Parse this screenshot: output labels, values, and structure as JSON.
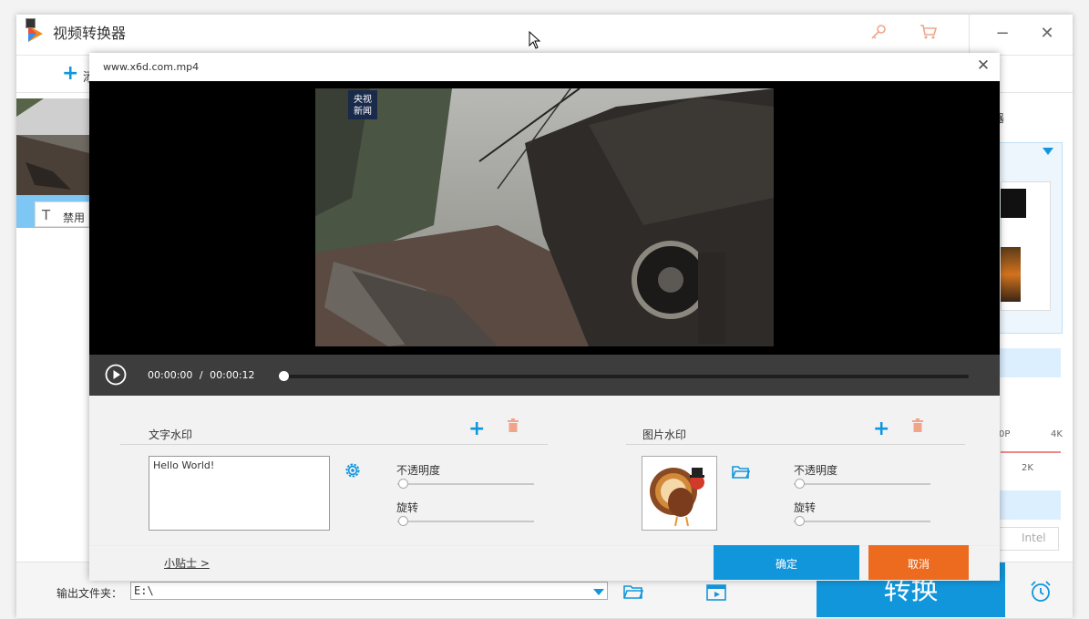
{
  "app": {
    "title": "视频转换器",
    "key_icon": "key-icon",
    "cart_icon": "cart-icon",
    "minimize_label": "−",
    "close_label": "✕"
  },
  "toolbar": {
    "add_label": "添"
  },
  "file_item": {
    "disable_label": "禁用",
    "text_icon": "T"
  },
  "right_panel": {
    "partial_label": "器",
    "scale_labels": [
      "0P",
      "4K"
    ],
    "scale_mid": "2K",
    "gpu_label": "Intel"
  },
  "bottom": {
    "output_label": "输出文件夹：",
    "output_value": "E:\\",
    "convert_label": "转换"
  },
  "dialog": {
    "title": "www.x6d.com.mp4",
    "close_label": "✕",
    "player": {
      "current_time": "00:00:00",
      "separator": "/",
      "total_time": "00:00:12",
      "progress": 0,
      "video_logo_line1": "央视",
      "video_logo_line2": "新闻"
    },
    "text_watermark": {
      "title": "文字水印",
      "text": "Hello World!",
      "opacity_label": "不透明度",
      "opacity_value": 0,
      "rotate_label": "旋转",
      "rotate_value": 0
    },
    "image_watermark": {
      "title": "图片水印",
      "opacity_label": "不透明度",
      "opacity_value": 0,
      "rotate_label": "旋转",
      "rotate_value": 0
    },
    "tips_label": "小贴士 >",
    "ok_label": "确定",
    "cancel_label": "取消"
  },
  "colors": {
    "accent": "#1296db",
    "cancel": "#ec6b1e",
    "delete_icon": "#f0a58a"
  }
}
